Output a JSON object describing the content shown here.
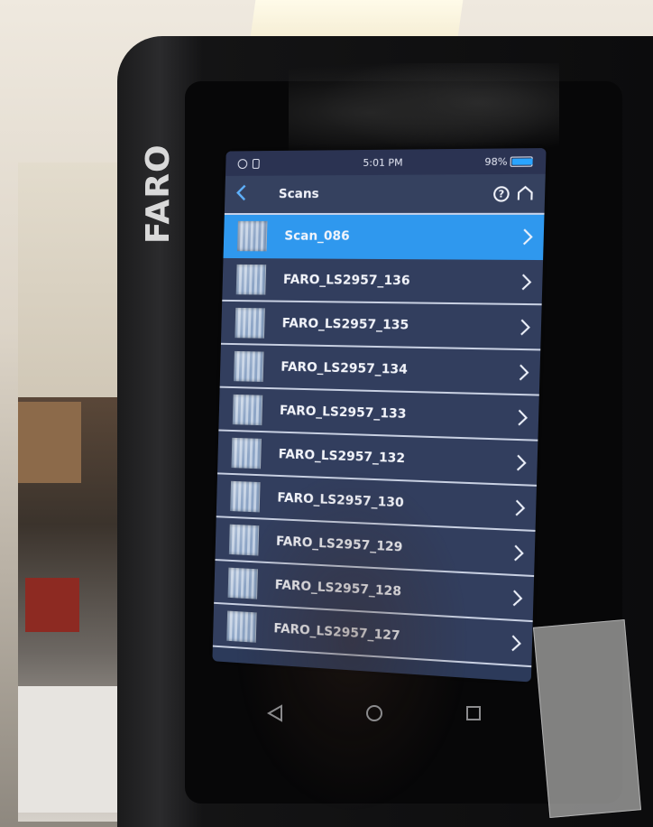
{
  "device": {
    "brand": "FARO"
  },
  "status_bar": {
    "time": "5:01 PM",
    "battery": "98%",
    "battery_level": 0.98,
    "icons": [
      "globe-icon",
      "sim-card-icon",
      "battery-icon"
    ]
  },
  "header": {
    "back_icon": "chevron-left-icon",
    "back_glyph": "<",
    "title": "Scans",
    "help_glyph": "?",
    "help_icon": "help-circle-icon",
    "home_icon": "home-icon"
  },
  "scans": {
    "selected_index": 0,
    "items": [
      {
        "name": "Scan_086"
      },
      {
        "name": "FARO_LS2957_136"
      },
      {
        "name": "FARO_LS2957_135"
      },
      {
        "name": "FARO_LS2957_134"
      },
      {
        "name": "FARO_LS2957_133"
      },
      {
        "name": "FARO_LS2957_132"
      },
      {
        "name": "FARO_LS2957_130"
      },
      {
        "name": "FARO_LS2957_129"
      },
      {
        "name": "FARO_LS2957_128"
      },
      {
        "name": "FARO_LS2957_127"
      }
    ]
  },
  "nav_bar": {
    "icons": [
      "back-triangle-icon",
      "home-circle-icon",
      "recents-square-icon"
    ]
  },
  "colors": {
    "accent": "#2f98ee",
    "list_background": "#323e5e",
    "divider": "#c8d0e2"
  }
}
